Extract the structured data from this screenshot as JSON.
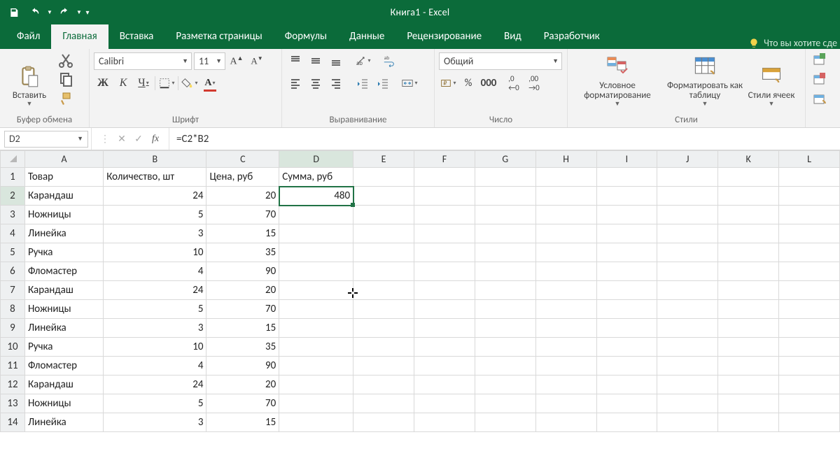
{
  "title": "Книга1  -  Excel",
  "tabs": [
    "Файл",
    "Главная",
    "Вставка",
    "Разметка страницы",
    "Формулы",
    "Данные",
    "Рецензирование",
    "Вид",
    "Разработчик"
  ],
  "active_tab_index": 1,
  "tell_me": "Что вы хотите сде",
  "ribbon": {
    "clipboard": {
      "paste": "Вставить",
      "label": "Буфер обмена"
    },
    "font": {
      "name": "Calibri",
      "size": "11",
      "label": "Шрифт"
    },
    "align": {
      "label": "Выравнивание"
    },
    "number": {
      "format": "Общий",
      "label": "Число"
    },
    "styles": {
      "cond": "Условное форматирование",
      "table": "Форматировать как таблицу",
      "cell": "Стили ячеек",
      "label": "Стили"
    }
  },
  "namebox": "D2",
  "formula": "=C2*B2",
  "columns": [
    "A",
    "B",
    "C",
    "D",
    "E",
    "F",
    "G",
    "H",
    "I",
    "J",
    "K",
    "L"
  ],
  "selected_col": "D",
  "selected_row": 2,
  "headers": [
    "Товар",
    "Количество, шт",
    "Цена, руб",
    "Сумма, руб"
  ],
  "rows": [
    {
      "a": "Карандаш",
      "b": 24,
      "c": 20,
      "d": 480
    },
    {
      "a": "Ножницы",
      "b": 5,
      "c": 70,
      "d": ""
    },
    {
      "a": "Линейка",
      "b": 3,
      "c": 15,
      "d": ""
    },
    {
      "a": "Ручка",
      "b": 10,
      "c": 35,
      "d": ""
    },
    {
      "a": "Фломастер",
      "b": 4,
      "c": 90,
      "d": ""
    },
    {
      "a": "Карандаш",
      "b": 24,
      "c": 20,
      "d": ""
    },
    {
      "a": "Ножницы",
      "b": 5,
      "c": 70,
      "d": ""
    },
    {
      "a": "Линейка",
      "b": 3,
      "c": 15,
      "d": ""
    },
    {
      "a": "Ручка",
      "b": 10,
      "c": 35,
      "d": ""
    },
    {
      "a": "Фломастер",
      "b": 4,
      "c": 90,
      "d": ""
    },
    {
      "a": "Карандаш",
      "b": 24,
      "c": 20,
      "d": ""
    },
    {
      "a": "Ножницы",
      "b": 5,
      "c": 70,
      "d": ""
    },
    {
      "a": "Линейка",
      "b": 3,
      "c": 15,
      "d": ""
    }
  ]
}
